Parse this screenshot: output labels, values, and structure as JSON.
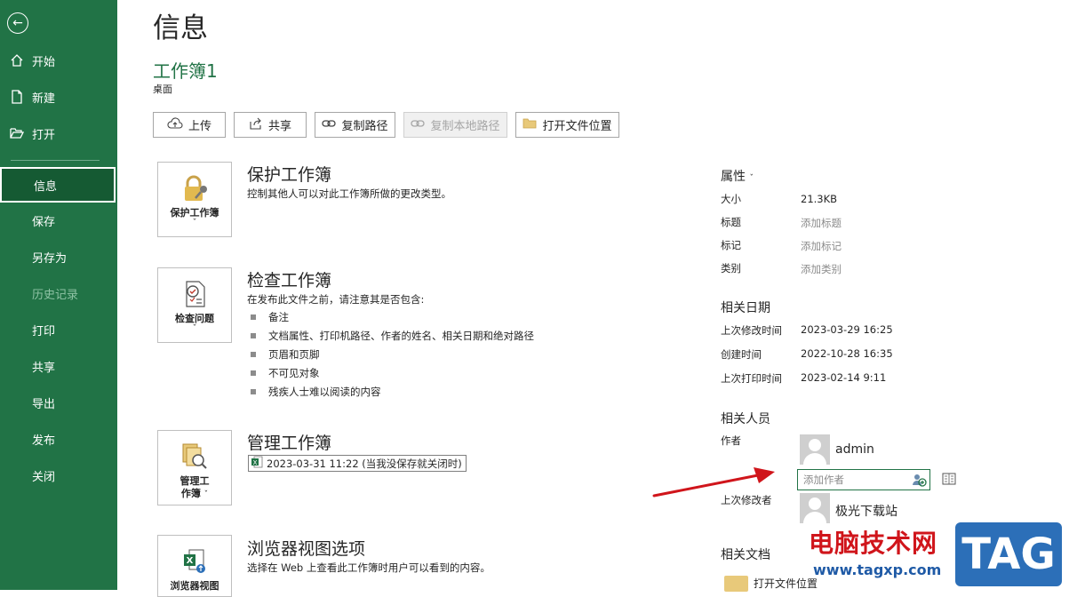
{
  "sidebar": {
    "items": [
      {
        "label": "开始",
        "icon": "home-icon"
      },
      {
        "label": "新建",
        "icon": "new-doc-icon"
      },
      {
        "label": "打开",
        "icon": "folder-open-icon"
      },
      {
        "label": "信息",
        "active": true
      },
      {
        "label": "保存"
      },
      {
        "label": "另存为"
      },
      {
        "label": "历史记录",
        "disabled": true
      },
      {
        "label": "打印"
      },
      {
        "label": "共享"
      },
      {
        "label": "导出"
      },
      {
        "label": "发布"
      },
      {
        "label": "关闭"
      }
    ]
  },
  "header": {
    "title": "信息",
    "workbook_name": "工作簿1",
    "location": "桌面"
  },
  "actions": {
    "upload": "上传",
    "share": "共享",
    "copy_path": "复制路径",
    "copy_local_path": "复制本地路径",
    "open_location": "打开文件位置"
  },
  "sections": {
    "protect": {
      "tile": "保护工作簿",
      "heading": "保护工作簿",
      "desc": "控制其他人可以对此工作簿所做的更改类型。"
    },
    "inspect": {
      "tile": "检查问题",
      "heading": "检查工作簿",
      "desc": "在发布此文件之前，请注意其是否包含:",
      "bullets": [
        "备注",
        "文档属性、打印机路径、作者的姓名、相关日期和绝对路径",
        "页眉和页脚",
        "不可见对象",
        "残疾人士难以阅读的内容"
      ]
    },
    "manage": {
      "tile_line1": "管理工",
      "tile_line2": "作簿",
      "heading": "管理工作簿",
      "version": "2023-03-31 11:22 (当我没保存就关闭时)"
    },
    "browser": {
      "tile": "浏览器视图",
      "heading": "浏览器视图选项",
      "desc": "选择在 Web 上查看此工作簿时用户可以看到的内容。"
    }
  },
  "properties": {
    "heading": "属性",
    "size_label": "大小",
    "size_value": "21.3KB",
    "title_label": "标题",
    "title_value": "添加标题",
    "tags_label": "标记",
    "tags_value": "添加标记",
    "category_label": "类别",
    "category_value": "添加类别",
    "dates_heading": "相关日期",
    "modified_label": "上次修改时间",
    "modified_value": "2023-03-29 16:25",
    "created_label": "创建时间",
    "created_value": "2022-10-28 16:35",
    "printed_label": "上次打印时间",
    "printed_value": "2023-02-14 9:11",
    "people_heading": "相关人员",
    "author_label": "作者",
    "author_name": "admin",
    "add_author_placeholder": "添加作者",
    "last_modified_by_label": "上次修改者",
    "last_modified_by": "极光下载站",
    "docs_heading": "相关文档",
    "open_location": "打开文件位置"
  },
  "watermark": {
    "cn": "电脑技术网",
    "url": "www.tagxp.com",
    "tag": "TAG"
  },
  "colors": {
    "sidebar": "#217346",
    "sidebar_active": "#155a33",
    "accent_green": "#217346",
    "arrow_red": "#d0151b",
    "watermark_blue": "#2c6fb8"
  }
}
